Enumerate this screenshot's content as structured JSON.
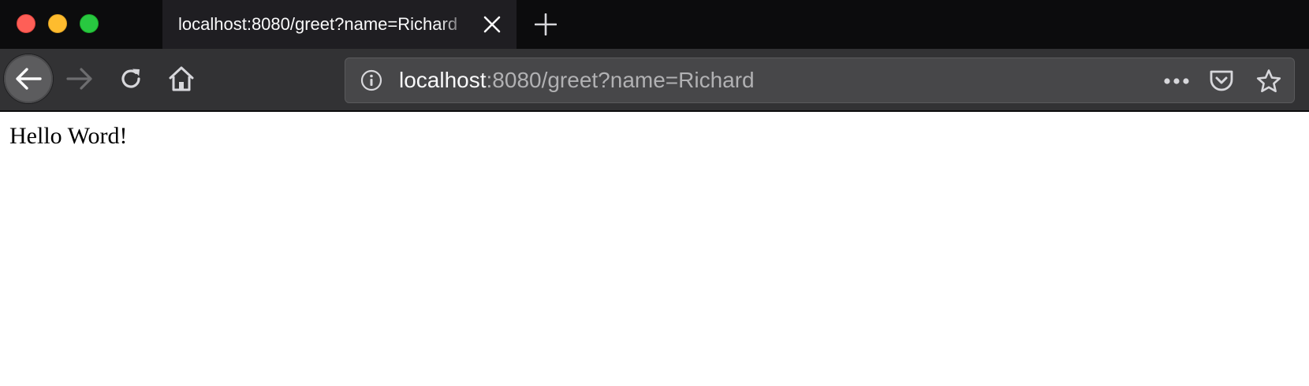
{
  "window": {
    "traffic_lights": {
      "close_color": "#fe5f57",
      "minimize_color": "#febc2e",
      "maximize_color": "#28c840"
    }
  },
  "tabs": [
    {
      "title": "localhost:8080/greet?name=Richard",
      "active": true
    }
  ],
  "toolbar": {
    "back_icon": "arrow-left-icon",
    "forward_icon": "arrow-right-icon",
    "reload_icon": "reload-icon",
    "home_icon": "home-icon",
    "newtab_icon": "plus-icon",
    "close_tab_icon": "close-icon"
  },
  "urlbar": {
    "host": "localhost",
    "rest": ":8080/greet?name=Richard",
    "site_info_icon": "info-icon",
    "page_actions_icon": "ellipsis-icon",
    "pocket_icon": "pocket-icon",
    "bookmark_icon": "star-icon"
  },
  "page": {
    "text": "Hello Word!"
  },
  "colors": {
    "tabstrip_bg": "#0c0c0d",
    "active_tab_bg": "#1f1e22",
    "toolbar_bg": "#323234",
    "urlbar_bg": "#474749",
    "url_host": "#f9f9fa",
    "url_rest": "#b1b1b3"
  }
}
